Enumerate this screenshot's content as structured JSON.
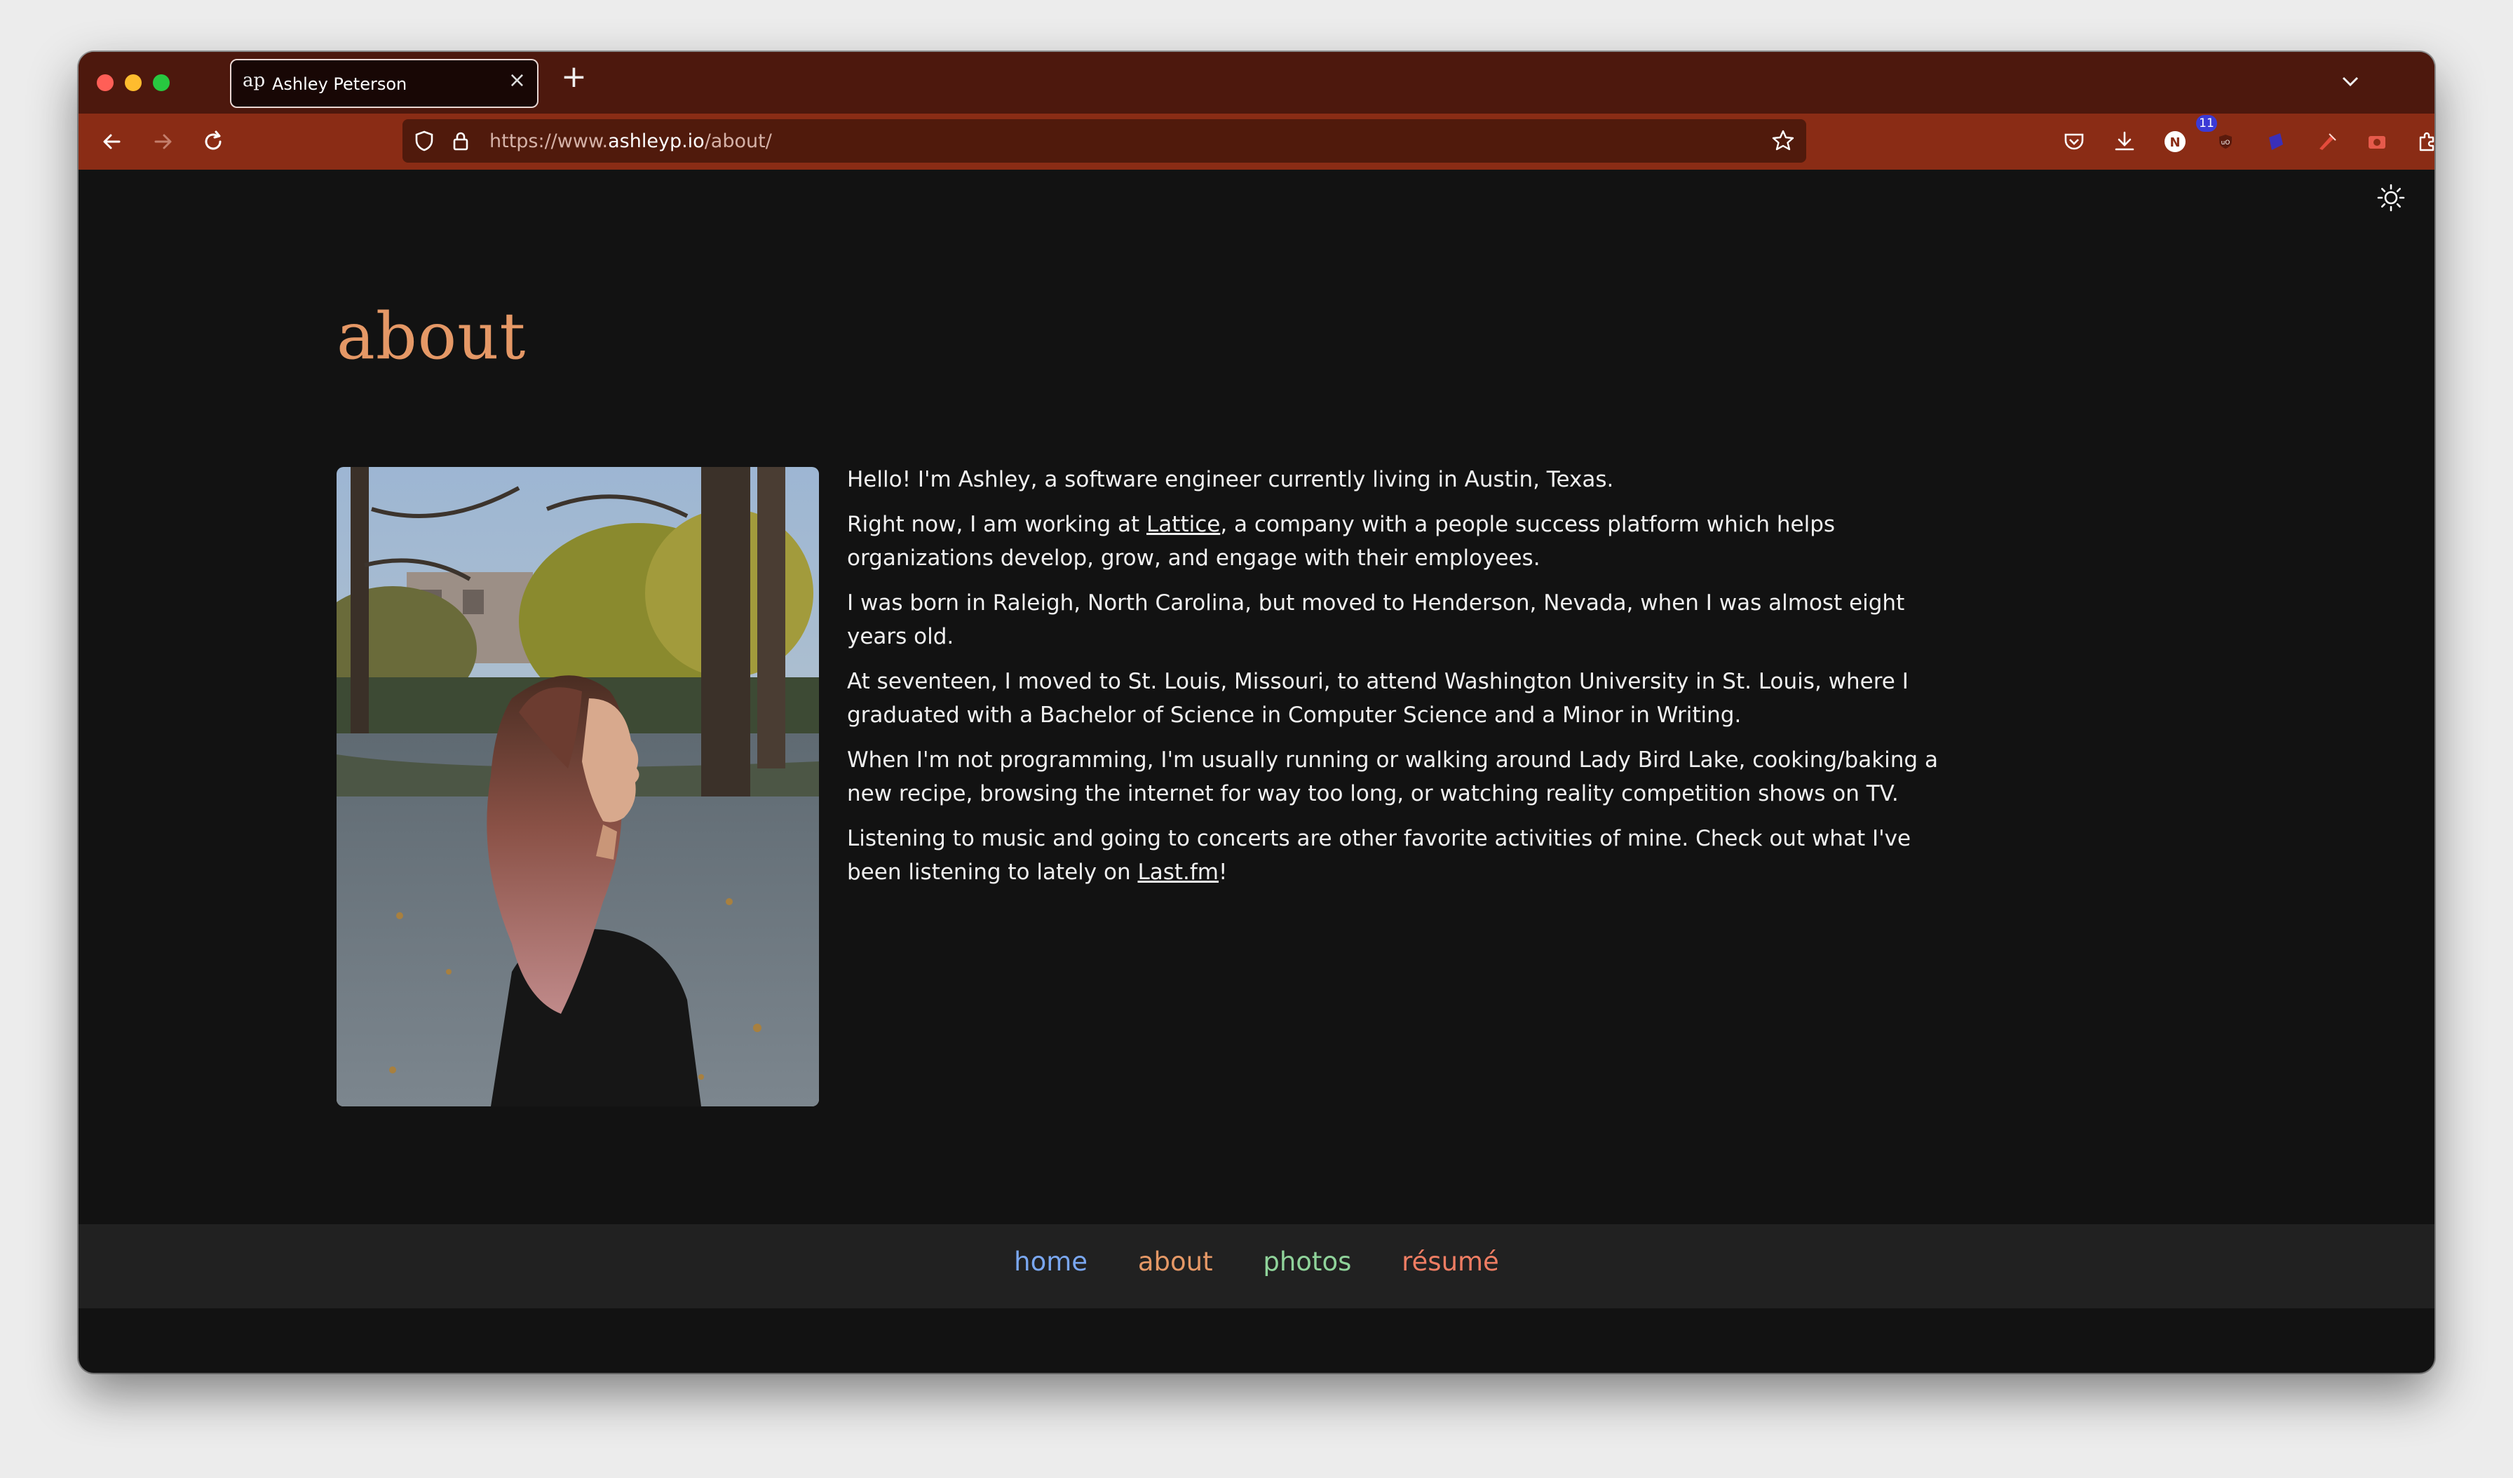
{
  "browser": {
    "tab": {
      "favicon": "ap",
      "title": "Ashley Peterson"
    },
    "url": {
      "prefix": "https://www.",
      "host": "ashleyp.io",
      "path": "/about/"
    },
    "toolbar_icons": [
      "pocket-icon",
      "download-icon",
      "notion-extension-icon",
      "ublock-icon",
      "extension-badge-icon",
      "pen-extension-icon",
      "screenshot-icon",
      "extensions-icon",
      "menu-icon"
    ],
    "extension_badge": "11",
    "colors": {
      "tab_strip": "#4d180d",
      "toolbar": "#8a2c15",
      "urlbar": "#501a0c"
    }
  },
  "page": {
    "title": "about",
    "bio": {
      "p1": "Hello! I'm Ashley, a software engineer currently living in Austin, Texas.",
      "p2_before": "Right now, I am working at ",
      "p2_link": "Lattice",
      "p2_after": ", a company with a people success platform which helps organizations develop, grow, and engage with their employees.",
      "p3": "I was born in Raleigh, North Carolina, but moved to Henderson, Nevada, when I was almost eight years old.",
      "p4": "At seventeen, I moved to St. Louis, Missouri, to attend Washington University in St. Louis, where I graduated with a Bachelor of Science in Computer Science and a Minor in Writing.",
      "p5": "When I'm not programming, I'm usually running or walking around Lady Bird Lake, cooking/baking a new recipe, browsing the internet for way too long, or watching reality competition shows on TV.",
      "p6_before": "Listening to music and going to concerts are other favorite activities of mine. Check out what I've been listening to lately on ",
      "p6_link": "Last.fm",
      "p6_after": "!"
    },
    "footer_nav": [
      {
        "label": "home",
        "color": "#7aa7f0"
      },
      {
        "label": "about",
        "color": "#e59866"
      },
      {
        "label": "photos",
        "color": "#8fd39a"
      },
      {
        "label": "résumé",
        "color": "#ef7d63"
      }
    ],
    "colors": {
      "background": "#121212",
      "footer": "#212121",
      "title": "#e59866"
    }
  }
}
